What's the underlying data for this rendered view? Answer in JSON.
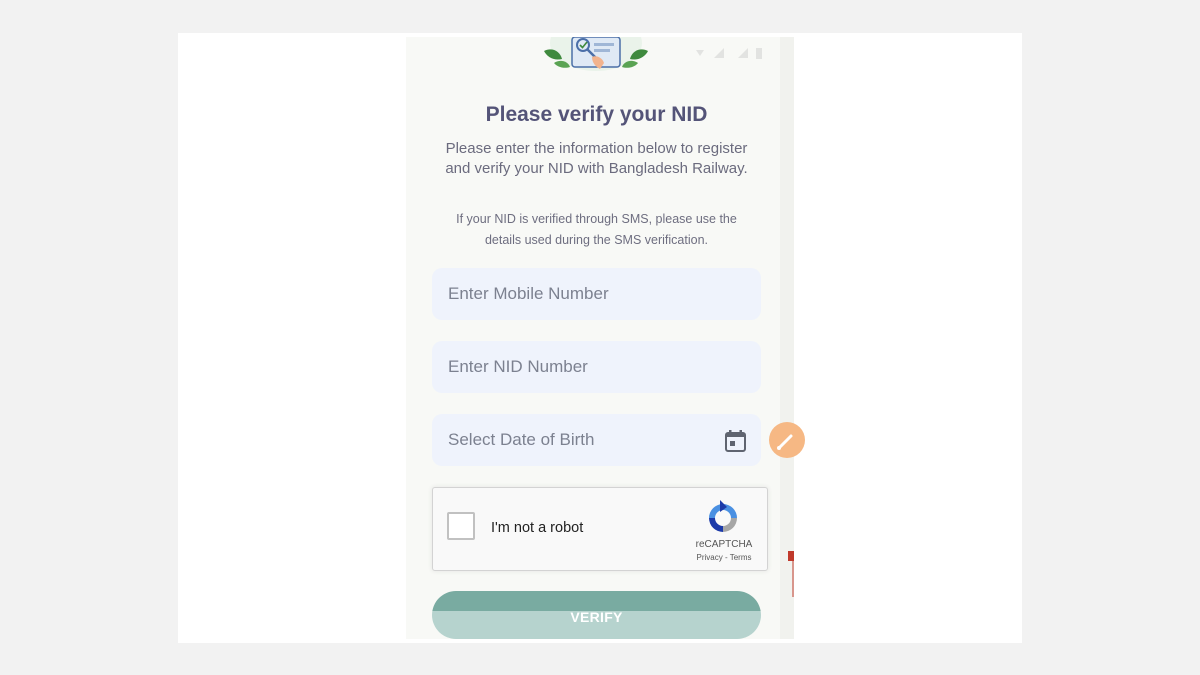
{
  "header": {
    "title": "Please verify your NID",
    "subtitle": "Please enter the information below to register and verify your NID with Bangladesh Railway.",
    "note": "If your NID is verified through SMS, please use the details used during the SMS verification."
  },
  "form": {
    "mobile_placeholder": "Enter Mobile Number",
    "nid_placeholder": "Enter NID Number",
    "dob_placeholder": "Select Date of Birth",
    "dob_icon": "calendar-icon"
  },
  "recaptcha": {
    "label": "I'm not a robot",
    "brand": "reCAPTCHA",
    "links": "Privacy - Terms",
    "checked": false
  },
  "actions": {
    "verify_label": "VERIFY"
  },
  "colors": {
    "title": "#545478",
    "field_background": "#eff3fc",
    "verify_button": "#79aba1",
    "fab": "#f6b884"
  }
}
